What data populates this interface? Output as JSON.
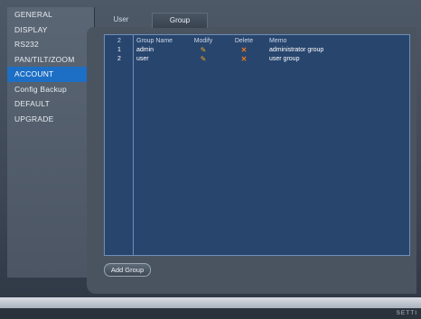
{
  "sidebar": {
    "items": [
      {
        "label": "GENERAL"
      },
      {
        "label": "DISPLAY"
      },
      {
        "label": "RS232"
      },
      {
        "label": "PAN/TILT/ZOOM"
      },
      {
        "label": "ACCOUNT",
        "active": true
      },
      {
        "label": "Config Backup"
      },
      {
        "label": "DEFAULT"
      },
      {
        "label": "UPGRADE"
      }
    ]
  },
  "tabs": {
    "user": "User",
    "group": "Group",
    "active": "Group"
  },
  "table": {
    "headers": {
      "num": "2",
      "name": "Group Name",
      "modify": "Modify",
      "delete": "Delete",
      "memo": "Memo"
    },
    "rows": [
      {
        "num": "1",
        "name": "admin",
        "memo": "administrator group",
        "modify_icon": "pencil-icon",
        "delete_icon": "close-icon"
      },
      {
        "num": "2",
        "name": "user",
        "memo": "user group",
        "modify_icon": "pencil-icon",
        "delete_icon": "close-icon"
      }
    ]
  },
  "actions": {
    "add_group": "Add Group"
  },
  "status": {
    "text": "SETTI"
  },
  "colors": {
    "accent": "#1c6fc4",
    "table_bg": "#28456e",
    "modify_icon": "#f3a21b",
    "delete_icon": "#f07b1c"
  }
}
